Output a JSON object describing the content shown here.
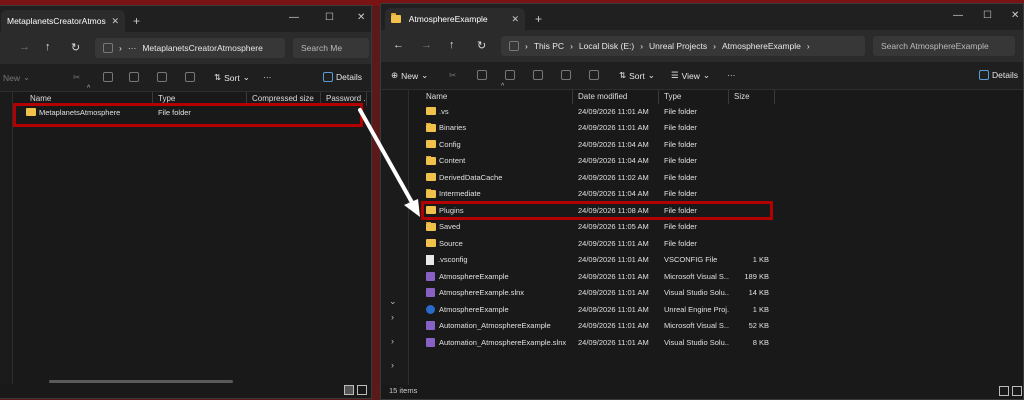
{
  "left_window": {
    "tab_title": "MetaplanetsCreatorAtmosphere",
    "address": "MetaplanetsCreatorAtmosphere",
    "search_placeholder": "Search Me",
    "toolbar": {
      "new": "New",
      "sort": "Sort",
      "more": "···",
      "details": "Details"
    },
    "columns": [
      "Name",
      "Type",
      "Compressed size",
      "Password ..."
    ],
    "rows": [
      {
        "name": "MetaplanetsAtmosphere",
        "type": "File folder"
      }
    ]
  },
  "right_window": {
    "tab_title": "AtmosphereExample",
    "breadcrumb": [
      "This PC",
      "Local Disk (E:)",
      "Unreal Projects",
      "AtmosphereExample"
    ],
    "search_placeholder": "Search AtmosphereExample",
    "toolbar": {
      "new": "New",
      "sort": "Sort",
      "view": "View",
      "more": "···",
      "details": "Details"
    },
    "columns": [
      "Name",
      "Date modified",
      "Type",
      "Size"
    ],
    "rows": [
      {
        "name": ".vs",
        "date": "24/09/2026 11:01 AM",
        "type": "File folder",
        "size": "",
        "icon": "folder"
      },
      {
        "name": "Binaries",
        "date": "24/09/2026 11:01 AM",
        "type": "File folder",
        "size": "",
        "icon": "folder"
      },
      {
        "name": "Config",
        "date": "24/09/2026 11:04 AM",
        "type": "File folder",
        "size": "",
        "icon": "folder"
      },
      {
        "name": "Content",
        "date": "24/09/2026 11:04 AM",
        "type": "File folder",
        "size": "",
        "icon": "folder"
      },
      {
        "name": "DerivedDataCache",
        "date": "24/09/2026 11:02 AM",
        "type": "File folder",
        "size": "",
        "icon": "folder"
      },
      {
        "name": "Intermediate",
        "date": "24/09/2026 11:04 AM",
        "type": "File folder",
        "size": "",
        "icon": "folder"
      },
      {
        "name": "Plugins",
        "date": "24/09/2026 11:08 AM",
        "type": "File folder",
        "size": "",
        "icon": "folder"
      },
      {
        "name": "Saved",
        "date": "24/09/2026 11:05 AM",
        "type": "File folder",
        "size": "",
        "icon": "folder"
      },
      {
        "name": "Source",
        "date": "24/09/2026 11:01 AM",
        "type": "File folder",
        "size": "",
        "icon": "folder"
      },
      {
        "name": ".vsconfig",
        "date": "24/09/2026 11:01 AM",
        "type": "VSCONFIG File",
        "size": "1 KB",
        "icon": "file"
      },
      {
        "name": "AtmosphereExample",
        "date": "24/09/2026 11:01 AM",
        "type": "Microsoft Visual S...",
        "size": "189 KB",
        "icon": "vs"
      },
      {
        "name": "AtmosphereExample.slnx",
        "date": "24/09/2026 11:01 AM",
        "type": "Visual Studio Solu...",
        "size": "14 KB",
        "icon": "vs"
      },
      {
        "name": "AtmosphereExample",
        "date": "24/09/2026 11:01 AM",
        "type": "Unreal Engine Proj...",
        "size": "1 KB",
        "icon": "ue"
      },
      {
        "name": "Automation_AtmosphereExample",
        "date": "24/09/2026 11:01 AM",
        "type": "Microsoft Visual S...",
        "size": "52 KB",
        "icon": "vs"
      },
      {
        "name": "Automation_AtmosphereExample.slnx",
        "date": "24/09/2026 11:01 AM",
        "type": "Visual Studio Solu...",
        "size": "8 KB",
        "icon": "vs"
      }
    ],
    "status": "15 items"
  },
  "colors": {
    "highlight": "#b30000",
    "folder": "#f0c14b"
  }
}
